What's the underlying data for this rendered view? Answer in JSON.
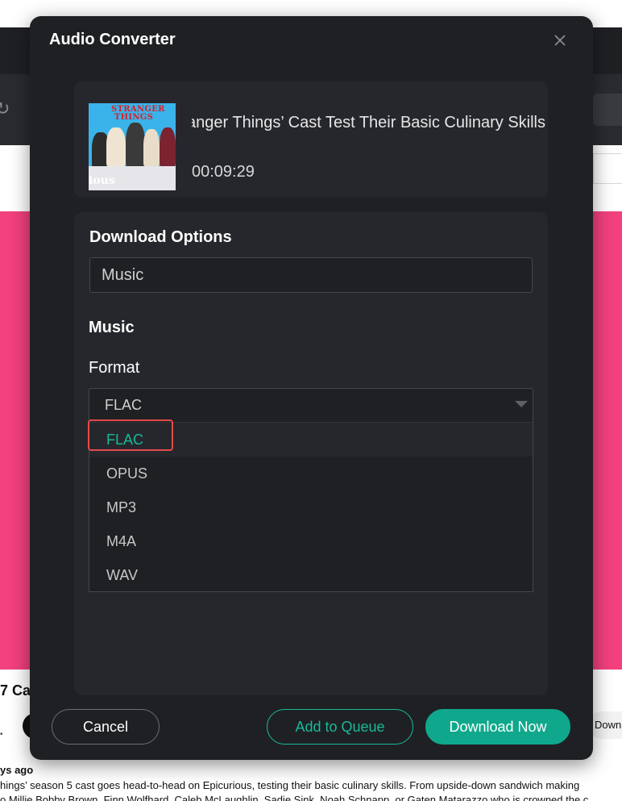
{
  "background": {
    "refresh_glyph": "↻",
    "title_fragment": "7 Cas",
    "dot_text": "•",
    "download_button_fragment": "Down",
    "posted": "ys ago",
    "description_line1": "hings’ season 5 cast goes head-to-head on Epicurious, testing their basic culinary skills. From upside-down sandwich making",
    "description_line2": "o Millie Bobby Brown, Finn Wolfhard, Caleb McLaughlin, Sadie Sink, Noah Schnapp, or Gaten Matarazzo who is crowned the c",
    "accent_pink": "#f2417e"
  },
  "dialog": {
    "title": "Audio Converter",
    "close_icon": "close-icon"
  },
  "video": {
    "thumbnail_logo_line1": "STRANGER",
    "thumbnail_logo_line2": "THINGS",
    "thumbnail_brand": "ious",
    "title": "‘Stranger Things’ Cast Test Their Basic Culinary Skills | Epicurious",
    "duration": "00:09:29"
  },
  "download_options": {
    "heading": "Download Options",
    "type_value": "Music"
  },
  "music": {
    "heading": "Music",
    "format_label": "Format",
    "format_value": "FLAC",
    "options": [
      "FLAC",
      "OPUS",
      "MP3",
      "M4A",
      "WAV"
    ],
    "selected_index": 0
  },
  "buttons": {
    "cancel": "Cancel",
    "add_to_queue": "Add to Queue",
    "download_now": "Download Now"
  },
  "colors": {
    "modal_bg": "#1f2024",
    "panel_bg": "#26272c",
    "accent_teal": "#0fa88c",
    "highlight_red": "#e24b4b"
  }
}
